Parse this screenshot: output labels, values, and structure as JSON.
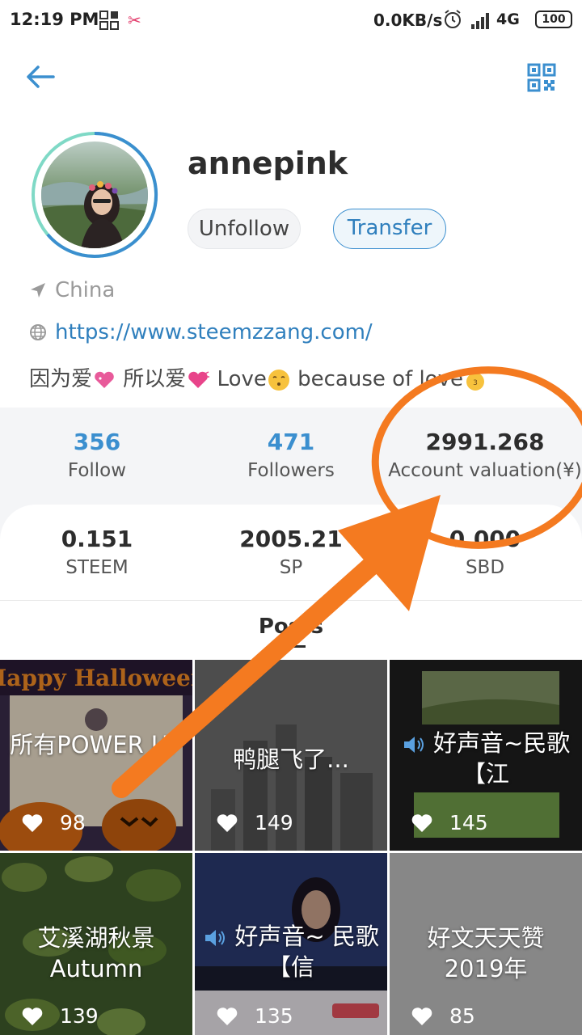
{
  "status_bar": {
    "time": "12:19 PM",
    "net_speed": "0.0KB/s",
    "network": "4G",
    "battery": "100"
  },
  "profile": {
    "username": "annepink",
    "unfollow_label": "Unfollow",
    "transfer_label": "Transfer",
    "location": "China",
    "website": "https://www.steemzzang.com/",
    "bio": {
      "part1": "因为爱",
      "part2": " 所以爱",
      "part3": " Love",
      "part4": "  because of love"
    }
  },
  "stats": {
    "follow": {
      "value": "356",
      "label": "Follow"
    },
    "followers": {
      "value": "471",
      "label": "Followers"
    },
    "valuation": {
      "value": "2991.268",
      "label": "Account valuation(¥)"
    },
    "steem": {
      "value": "0.151",
      "label": "STEEM"
    },
    "sp": {
      "value": "2005.21",
      "label": "SP"
    },
    "sbd": {
      "value": "0.000",
      "label": "SBD"
    }
  },
  "posts_tab": "Posts",
  "posts": [
    {
      "title": "所有POWER UP",
      "likes": "98"
    },
    {
      "title": "鸭腿飞了...",
      "likes": "149"
    },
    {
      "title": "好声音~民歌【江",
      "likes": "145"
    },
    {
      "title": "艾溪湖秋景Autumn",
      "likes": "139"
    },
    {
      "title": "好声音~ 民歌【信",
      "likes": "135"
    },
    {
      "title": "好文天天赞2019年",
      "likes": "85"
    }
  ],
  "colors": {
    "accent": "#3b8fcf",
    "annotation": "#f47a20"
  },
  "icons": [
    "back-arrow-icon",
    "qr-code-icon",
    "location-icon",
    "globe-icon",
    "heart-icon",
    "speaker-icon"
  ]
}
